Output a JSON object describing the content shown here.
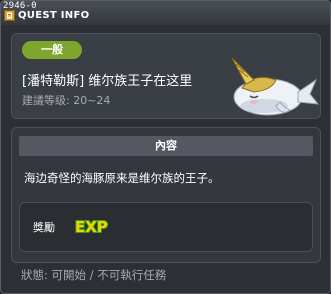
{
  "window": {
    "quest_id": "2946-0",
    "title": "QUEST INFO"
  },
  "header": {
    "category_badge": "一般",
    "quest_title": "[潘特勒斯] 维尔族王子在这里",
    "level_label": "建議等级: 20~24",
    "npc_icon": "white-narwhal-unicorn-icon"
  },
  "content": {
    "section_title": "內容",
    "description": "海边奇怪的海豚原来是维尔族的王子。",
    "reward": {
      "label": "獎勵",
      "item": "EXP",
      "item_icon": "exp-icon"
    }
  },
  "status": {
    "text": "狀態: 可開始 / 不可執行任務"
  },
  "colors": {
    "badge_green": "#7ea52c",
    "exp_yellow": "#f2d200",
    "exp_green": "#3a9a1c",
    "panel": "#3a3e45",
    "window_bg": "#2c3036"
  }
}
